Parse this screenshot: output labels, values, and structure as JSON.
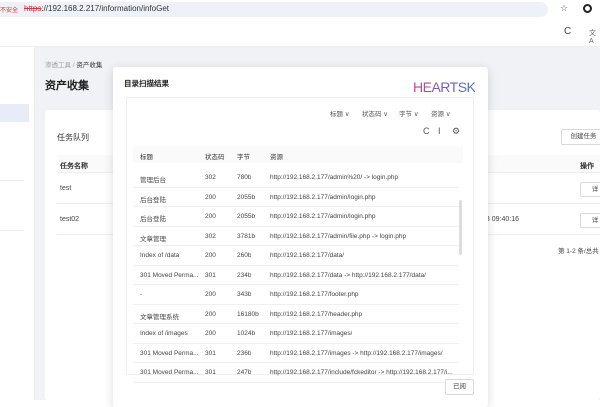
{
  "browser": {
    "insecure": "不安全",
    "url_scheme": "https",
    "url_rest": "://192.168.2.217/information/infoGet",
    "icons": [
      "star-icon",
      "extension-icon",
      "reload-icon",
      "translate-icon"
    ]
  },
  "breadcrumb": {
    "parent": "渗透工具",
    "current": "资产收集"
  },
  "page_title": "资产收集",
  "tasks": {
    "title": "任务队列",
    "create_label": "创建任务",
    "headers": {
      "name": "任务名称",
      "action": "操作"
    },
    "rows": [
      {
        "name": "test",
        "time": "",
        "action": "详"
      },
      {
        "name": "test02",
        "time": "13 09:40:16",
        "action": "详"
      }
    ],
    "pager": "第 1-2 条/总共"
  },
  "modal": {
    "title": "目录扫描结果",
    "logo": "HEARTSK",
    "filters": [
      "标题",
      "状态码",
      "字节",
      "资源"
    ],
    "headers": [
      "标题",
      "状态码",
      "字节",
      "资源"
    ],
    "rows": [
      [
        "管理后台",
        "302",
        "780b",
        "http://192.168.2.177/admin%20/ -> login.php"
      ],
      [
        "后台登陆",
        "200",
        "2055b",
        "http://192.168.2.177/admin/login.php"
      ],
      [
        "后台登陆",
        "200",
        "2055b",
        "http://192.168.2.177/admin/login.php"
      ],
      [
        "文章管理",
        "302",
        "3781b",
        "http://192.168.2.177/admin/file.php -> login.php"
      ],
      [
        "Index of /data",
        "200",
        "260b",
        "http://192.168.2.177/data/"
      ],
      [
        "301 Moved Perma...",
        "301",
        "234b",
        "http://192.168.2.177/data -> http://192.168.2.177/data/"
      ],
      [
        "-",
        "200",
        "343b",
        "http://192.168.2.177/footer.php"
      ],
      [
        "文章管理系统",
        "200",
        "16180b",
        "http://192.168.2.177/header.php"
      ],
      [
        "Index of /images",
        "200",
        "1024b",
        "http://192.168.2.177/images/"
      ],
      [
        "301 Moved Perma...",
        "301",
        "236b",
        "http://192.168.2.177/images -> http://192.168.2.177/images/"
      ],
      [
        "301 Moved Perma...",
        "301",
        "247b",
        "http://192.168.2.177/include/fckeditor -> http://192.168.2.177/i..."
      ]
    ],
    "ok_label": "已阅"
  }
}
